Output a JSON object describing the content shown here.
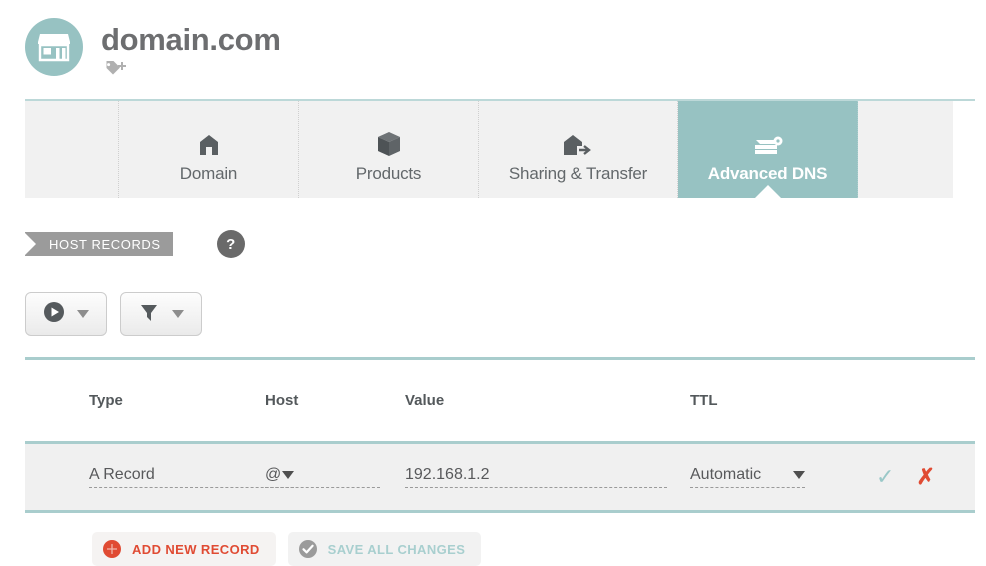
{
  "header": {
    "domain": "domain.com",
    "logo_icon": "storefront-icon",
    "tag_icon": "add-tag-icon",
    "logo_color": "#97c2c2"
  },
  "tabs": [
    {
      "label": "Domain",
      "icon": "house-icon",
      "active": false
    },
    {
      "label": "Products",
      "icon": "box-icon",
      "active": false
    },
    {
      "label": "Sharing & Transfer",
      "icon": "house-arrow-icon",
      "active": false
    },
    {
      "label": "Advanced DNS",
      "icon": "server-gear-icon",
      "active": true
    }
  ],
  "section": {
    "badge": "HOST RECORDS",
    "help": "?",
    "badge_color": "#9b9b9b"
  },
  "toolbar": {
    "buttons": [
      {
        "name": "record-actions-dropdown",
        "icon": "play-circle-icon"
      },
      {
        "name": "filter-dropdown",
        "icon": "funnel-icon"
      }
    ]
  },
  "table": {
    "columns": [
      "Type",
      "Host",
      "Value",
      "TTL"
    ],
    "rows": [
      {
        "type": "A Record",
        "host": "@",
        "value": "192.168.1.2",
        "ttl": "Automatic",
        "confirm_icon": "check-icon",
        "delete_icon": "close-x-icon"
      }
    ],
    "accent_color": "#a9cdcd",
    "row_bg": "#f0f0f0"
  },
  "footer": {
    "add_label": "ADD NEW RECORD",
    "save_label": "SAVE ALL CHANGES",
    "add_icon": "plus-circle-icon",
    "save_icon": "check-circle-icon",
    "add_color": "#e04b33",
    "save_color": "#a8cfcf"
  }
}
